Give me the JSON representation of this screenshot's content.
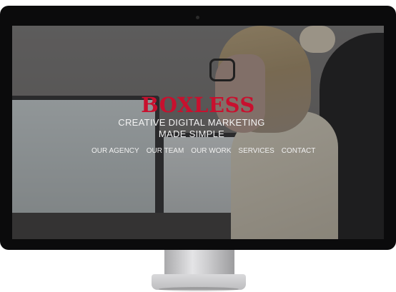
{
  "site": {
    "logo": "BOXLESS",
    "tagline_line1": "CREATIVE DIGITAL MARKETING",
    "tagline_line2": "MADE SIMPLE"
  },
  "nav": {
    "items": [
      {
        "label": "OUR AGENCY"
      },
      {
        "label": "OUR TEAM"
      },
      {
        "label": "OUR WORK"
      },
      {
        "label": "SERVICES"
      },
      {
        "label": "CONTACT"
      }
    ]
  },
  "colors": {
    "brand": "#c8102e",
    "text": "#f2f2f2",
    "bezel": "#0b0b0c",
    "stand": "#cfcfd1"
  }
}
